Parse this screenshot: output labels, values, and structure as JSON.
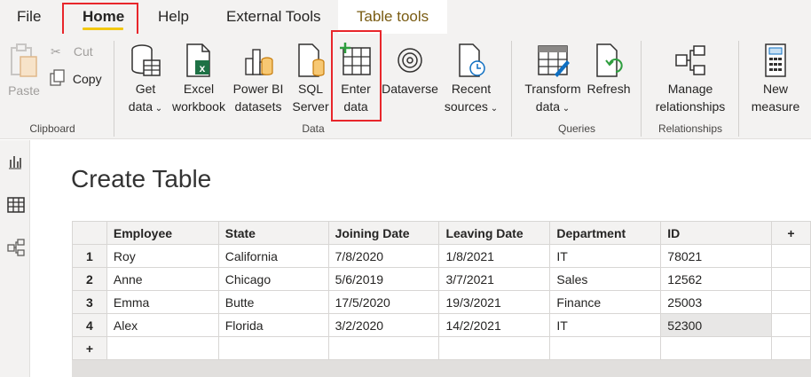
{
  "menu": {
    "tabs": [
      "File",
      "Home",
      "Help",
      "External Tools"
    ],
    "contextual_tab": "Table tools"
  },
  "ribbon": {
    "clipboard": {
      "paste": "Paste",
      "cut": "Cut",
      "copy": "Copy",
      "group_label": "Clipboard"
    },
    "data": {
      "get_data": [
        "Get",
        "data"
      ],
      "excel_workbook": [
        "Excel",
        "workbook"
      ],
      "power_bi_datasets": [
        "Power BI",
        "datasets"
      ],
      "sql_server": [
        "SQL",
        "Server"
      ],
      "enter_data": [
        "Enter",
        "data"
      ],
      "dataverse": "Dataverse",
      "recent_sources": [
        "Recent",
        "sources"
      ],
      "group_label": "Data"
    },
    "queries": {
      "transform_data": [
        "Transform",
        "data"
      ],
      "refresh": "Refresh",
      "group_label": "Queries"
    },
    "relationships": {
      "manage_relationships": [
        "Manage",
        "relationships"
      ],
      "group_label": "Relationships"
    },
    "calculations": {
      "new_measure": [
        "New",
        "measure"
      ]
    }
  },
  "main": {
    "title": "Create Table",
    "table": {
      "columns": [
        "Employee",
        "State",
        "Joining Date",
        "Leaving Date",
        "Department",
        "ID"
      ],
      "add_column": "+",
      "add_row": "+",
      "rows": [
        {
          "num": "1",
          "cells": [
            "Roy",
            "California",
            "7/8/2020",
            "1/8/2021",
            "IT",
            "78021"
          ]
        },
        {
          "num": "2",
          "cells": [
            "Anne",
            "Chicago",
            "5/6/2019",
            "3/7/2021",
            "Sales",
            "12562"
          ]
        },
        {
          "num": "3",
          "cells": [
            "Emma",
            "Butte",
            "17/5/2020",
            "19/3/2021",
            "Finance",
            "25003"
          ]
        },
        {
          "num": "4",
          "cells": [
            "Alex",
            "Florida",
            "3/2/2020",
            "14/2/2021",
            "IT",
            "52300"
          ]
        }
      ]
    }
  },
  "colors": {
    "accent_yellow": "#f2c811",
    "highlight_red": "#e8262b",
    "excel_green": "#1e7145",
    "tabletools_text": "#7a5c13"
  }
}
